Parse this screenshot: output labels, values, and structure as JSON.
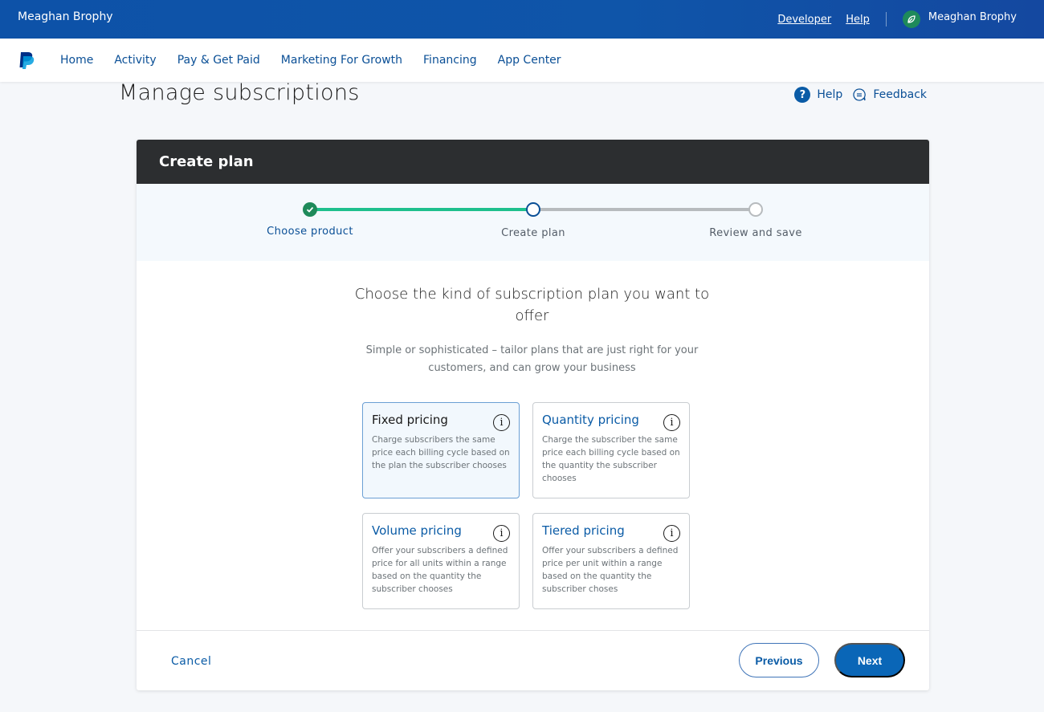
{
  "topbar": {
    "account_name": "Meaghan Brophy",
    "links": [
      "Developer",
      "Help"
    ],
    "user_name": "Meaghan Brophy",
    "avatar_icon": "leaf-icon"
  },
  "navbar": {
    "logo": "paypal-logo",
    "items": [
      "Home",
      "Activity",
      "Pay & Get Paid",
      "Marketing For Growth",
      "Financing",
      "App Center"
    ]
  },
  "page": {
    "title": "Manage subscriptions",
    "actions": {
      "help_label": "Help",
      "help_icon": "question-circle-icon",
      "feedback_label": "Feedback",
      "feedback_icon": "chat-bubble-icon"
    }
  },
  "card": {
    "header": "Create plan",
    "steps": [
      {
        "label": "Choose product",
        "state": "complete"
      },
      {
        "label": "Create plan",
        "state": "current"
      },
      {
        "label": "Review and save",
        "state": "pending"
      }
    ],
    "heading": "Choose the kind of subscription plan you want to offer",
    "subheading": "Simple or sophisticated – tailor plans that are just right for your customers, and can grow your business",
    "options": [
      {
        "title": "Fixed pricing",
        "description": "Charge subscribers the same price each billing cycle based on the plan the subscriber chooses",
        "selected": true
      },
      {
        "title": "Quantity pricing",
        "description": "Charge the subscriber the same price each billing cycle based on the quantity the subscriber chooses",
        "selected": false
      },
      {
        "title": "Volume pricing",
        "description": "Offer your subscribers a defined price for all units within a range based on the quantity the subscriber chooses",
        "selected": false
      },
      {
        "title": "Tiered pricing",
        "description": "Offer your subscribers a defined price per unit within a range based on the quantity the subscriber choses",
        "selected": false
      }
    ],
    "info_glyph": "i",
    "footer": {
      "cancel_label": "Cancel",
      "previous_label": "Previous",
      "next_label": "Next"
    }
  },
  "colors": {
    "brand_blue": "#0a66b7",
    "topbar_blue": "#0f55a9",
    "step_complete": "#1ec08d",
    "header_dark": "#2c2e30"
  }
}
